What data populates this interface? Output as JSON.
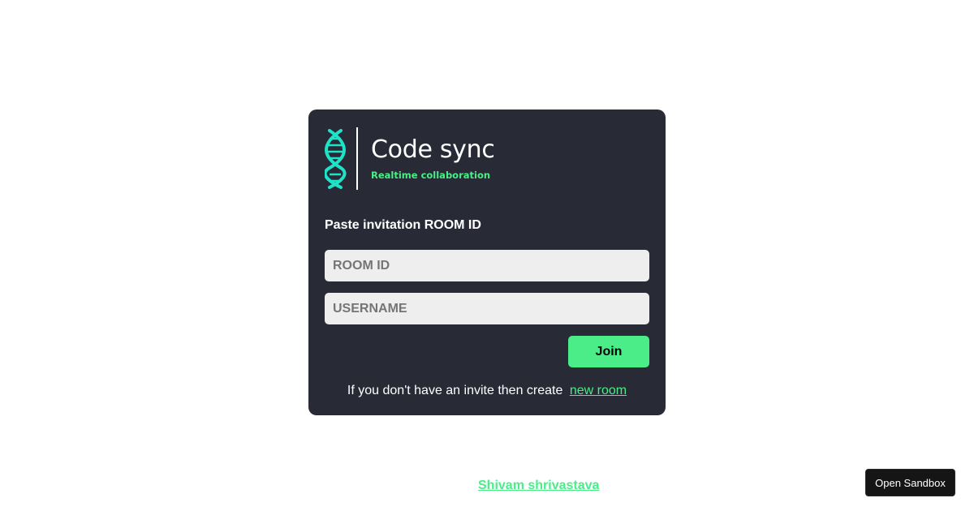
{
  "logo": {
    "icon": "dna-icon",
    "title": "Code sync",
    "subtitle": "Realtime collaboration"
  },
  "form": {
    "heading": "Paste invitation ROOM ID",
    "room_id_placeholder": "ROOM ID",
    "room_id_value": "",
    "username_placeholder": "USERNAME",
    "username_value": "",
    "join_label": "Join",
    "invite_text": "If you don't have an invite then create",
    "new_room_label": "new room"
  },
  "footer": {
    "author_link": "Shivam shrivastava"
  },
  "sandbox": {
    "button_label": "Open Sandbox"
  },
  "colors": {
    "accent": "#4aed88",
    "card_background": "#282a36",
    "input_background": "#eeeeee",
    "sandbox_background": "#151515"
  }
}
